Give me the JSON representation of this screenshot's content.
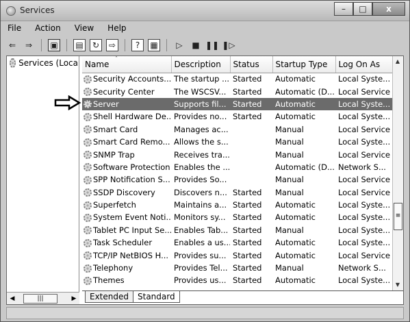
{
  "window": {
    "title": "Services"
  },
  "menubar": [
    "File",
    "Action",
    "View",
    "Help"
  ],
  "tree": {
    "label": "Services (Loca"
  },
  "columns": [
    "Name",
    "Description",
    "Status",
    "Startup Type",
    "Log On As"
  ],
  "rows": [
    {
      "name": "Security Accounts...",
      "description": "The startup ...",
      "status": "Started",
      "startup": "Automatic",
      "logon": "Local Syste..."
    },
    {
      "name": "Security Center",
      "description": "The WSCSV...",
      "status": "Started",
      "startup": "Automatic (D...",
      "logon": "Local Service"
    },
    {
      "name": "Server",
      "description": "Supports fil...",
      "status": "Started",
      "startup": "Automatic",
      "logon": "Local Syste..."
    },
    {
      "name": "Shell Hardware De...",
      "description": "Provides no...",
      "status": "Started",
      "startup": "Automatic",
      "logon": "Local Syste..."
    },
    {
      "name": "Smart Card",
      "description": "Manages ac...",
      "status": "",
      "startup": "Manual",
      "logon": "Local Service"
    },
    {
      "name": "Smart Card Remo...",
      "description": "Allows the s...",
      "status": "",
      "startup": "Manual",
      "logon": "Local Syste..."
    },
    {
      "name": "SNMP Trap",
      "description": "Receives tra...",
      "status": "",
      "startup": "Manual",
      "logon": "Local Service"
    },
    {
      "name": "Software Protection",
      "description": "Enables the ...",
      "status": "",
      "startup": "Automatic (D...",
      "logon": "Network S..."
    },
    {
      "name": "SPP Notification S...",
      "description": "Provides So...",
      "status": "",
      "startup": "Manual",
      "logon": "Local Service"
    },
    {
      "name": "SSDP Discovery",
      "description": "Discovers n...",
      "status": "Started",
      "startup": "Manual",
      "logon": "Local Service"
    },
    {
      "name": "Superfetch",
      "description": "Maintains a...",
      "status": "Started",
      "startup": "Automatic",
      "logon": "Local Syste..."
    },
    {
      "name": "System Event Noti...",
      "description": "Monitors sy...",
      "status": "Started",
      "startup": "Automatic",
      "logon": "Local Syste..."
    },
    {
      "name": "Tablet PC Input Se...",
      "description": "Enables Tab...",
      "status": "Started",
      "startup": "Manual",
      "logon": "Local Syste..."
    },
    {
      "name": "Task Scheduler",
      "description": "Enables a us...",
      "status": "Started",
      "startup": "Automatic",
      "logon": "Local Syste..."
    },
    {
      "name": "TCP/IP NetBIOS H...",
      "description": "Provides su...",
      "status": "Started",
      "startup": "Automatic",
      "logon": "Local Service"
    },
    {
      "name": "Telephony",
      "description": "Provides Tel...",
      "status": "Started",
      "startup": "Manual",
      "logon": "Network S..."
    },
    {
      "name": "Themes",
      "description": "Provides us...",
      "status": "Started",
      "startup": "Automatic",
      "logon": "Local Syste..."
    }
  ],
  "selected_row": "Server",
  "tabs": [
    "Extended",
    "Standard"
  ],
  "active_tab": "Standard",
  "colors": {
    "selection": "#6b6b6b",
    "selection_text": "#ffffff"
  }
}
